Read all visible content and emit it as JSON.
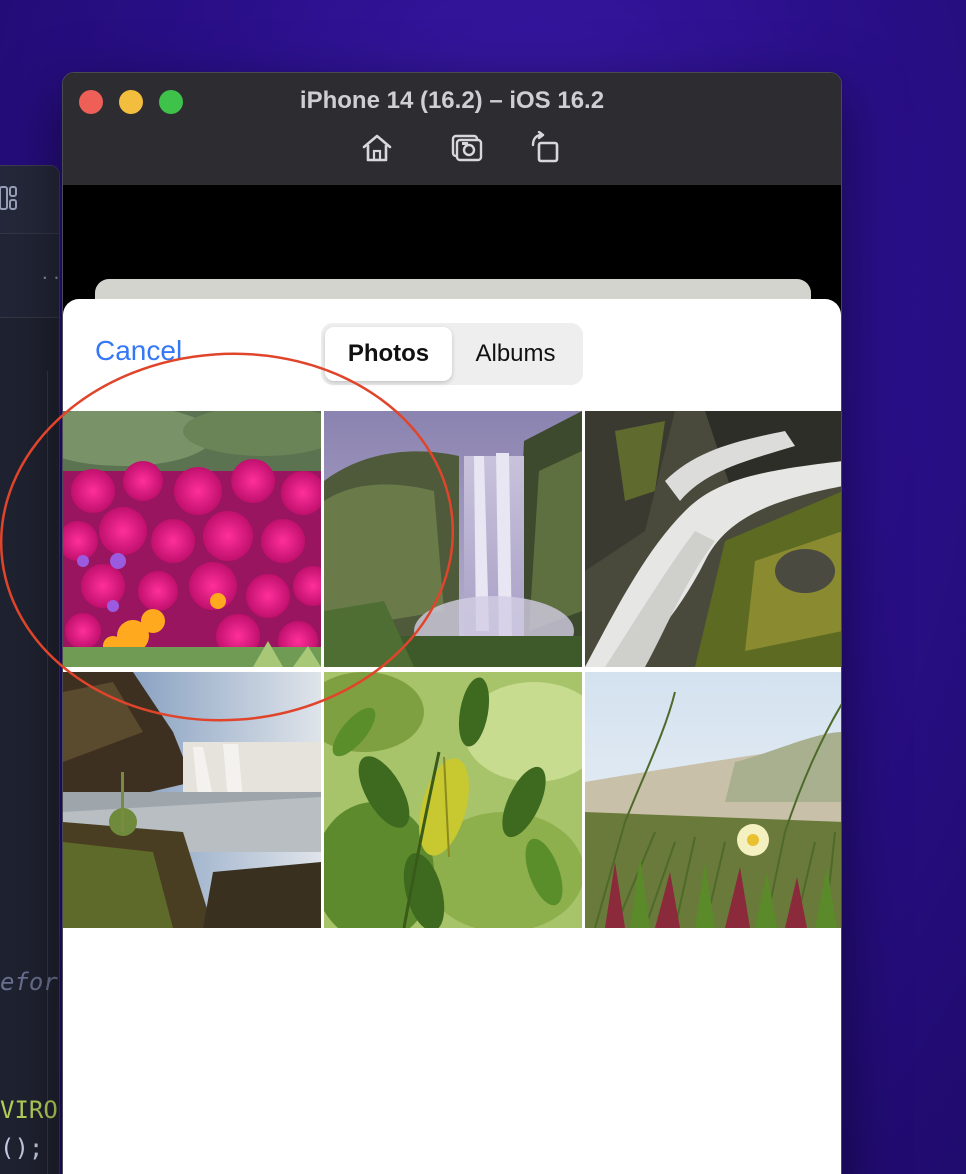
{
  "editor": {
    "overflow_dots": "..",
    "code_lines": [
      "efor",
      "VIRO",
      "();"
    ]
  },
  "window": {
    "title": "iPhone 14 (16.2) – iOS 16.2",
    "toolbar_icons": [
      "home-icon",
      "screenshot-icon",
      "rotate-icon"
    ]
  },
  "picker": {
    "cancel_label": "Cancel",
    "segments": [
      {
        "label": "Photos",
        "selected": true
      },
      {
        "label": "Albums",
        "selected": false
      }
    ],
    "photos": [
      {
        "name": "pink-flowers-photo"
      },
      {
        "name": "waterfall-cliff-photo"
      },
      {
        "name": "waterfall-rocks-photo"
      },
      {
        "name": "waterfall-river-photo"
      },
      {
        "name": "green-leaves-photo"
      },
      {
        "name": "beach-plants-photo"
      }
    ]
  },
  "colors": {
    "accent": "#3478f6",
    "annotation": "#e0452b",
    "traffic_red": "#ee5f57",
    "traffic_yellow": "#f3be3e",
    "traffic_green": "#3ec24a"
  }
}
